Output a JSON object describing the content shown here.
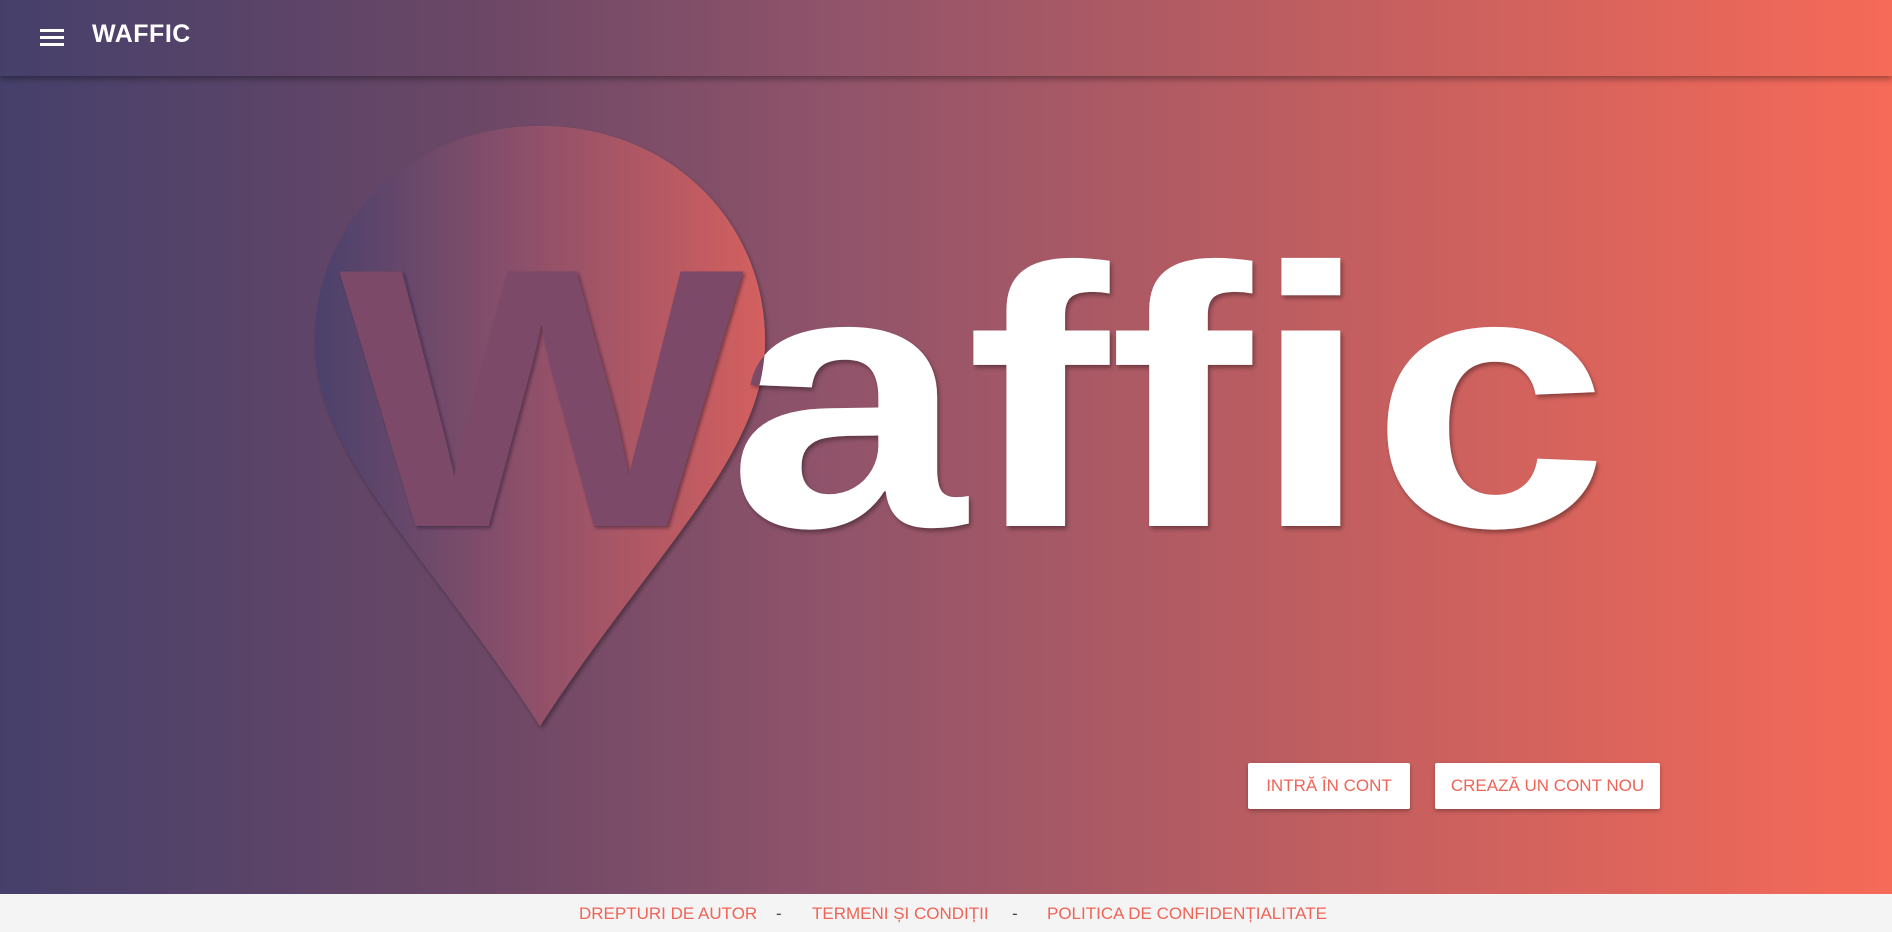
{
  "app": {
    "title": "WAFFIC"
  },
  "icons": {
    "menu": "menu-icon",
    "logo": "location-pin-icon"
  },
  "hero": {
    "logo_text": "Waffic"
  },
  "actions": {
    "login_label": "INTRĂ ÎN CONT",
    "register_label": "CREAZĂ UN CONT NOU"
  },
  "footer": {
    "links": [
      "DREPTURI DE AUTOR",
      "TERMENI ȘI CONDIȚII",
      "POLITICA DE CONFIDENȚIALITATE"
    ],
    "separator": "-"
  },
  "colors": {
    "gradient_start": "#45406b",
    "gradient_end": "#f66a58",
    "accent": "#ee6457",
    "footer_bg": "#f4f4f4"
  }
}
